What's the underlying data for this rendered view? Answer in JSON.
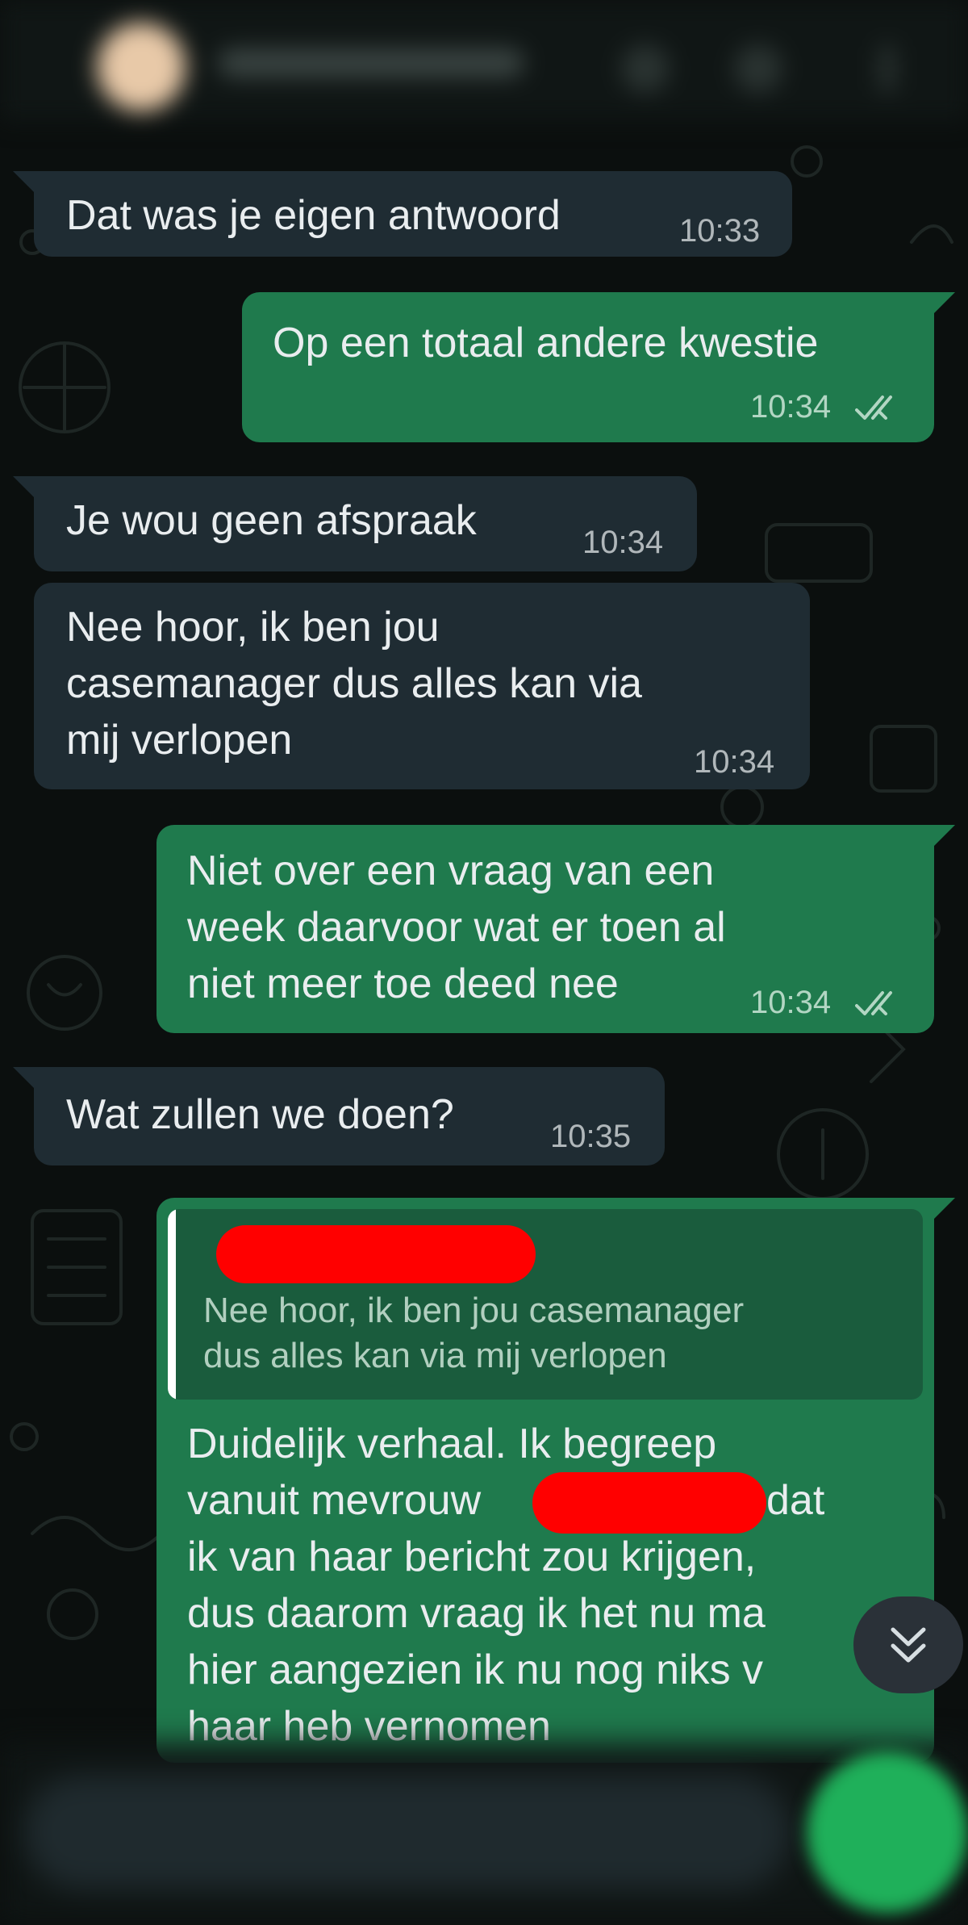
{
  "colors": {
    "incoming_bubble": "#1f2c33",
    "outgoing_bubble": "#1f7a4d",
    "background": "#0b0f0e",
    "accent": "#1fb05a",
    "redaction": "#ff0000"
  },
  "messages": [
    {
      "dir": "in",
      "lines": [
        "Dat was je eigen antwoord"
      ],
      "time": "10:33"
    },
    {
      "dir": "out",
      "lines": [
        "Op een totaal andere kwestie"
      ],
      "time": "10:34",
      "status": "read"
    },
    {
      "dir": "in",
      "lines": [
        "Je wou geen afspraak"
      ],
      "time": "10:34"
    },
    {
      "dir": "in",
      "lines": [
        "Nee hoor, ik ben jou",
        "casemanager dus alles kan via",
        "mij verlopen"
      ],
      "time": "10:34"
    },
    {
      "dir": "out",
      "lines": [
        "Niet over een vraag van een",
        "week daarvoor wat er toen al",
        "niet meer toe deed nee"
      ],
      "time": "10:34",
      "status": "read"
    },
    {
      "dir": "in",
      "lines": [
        "Wat zullen we doen?"
      ],
      "time": "10:35"
    },
    {
      "dir": "out",
      "quote": {
        "lines": [
          "Nee hoor, ik ben jou casemanager",
          "dus alles kan via mij verlopen"
        ]
      },
      "lines": [
        "Duidelijk verhaal. Ik begreep",
        "vanuit mevrouw",
        "ik van haar bericht zou krijgen,",
        "dus daarom vraag ik het nu ma",
        "hier aangezien ik nu nog niks v",
        "haar heb vernomen"
      ],
      "inline_after_redaction": "dat",
      "status": "read"
    }
  ],
  "icons": {
    "scroll_down": "double-chevron-down-icon",
    "read_receipt": "double-check-icon"
  }
}
